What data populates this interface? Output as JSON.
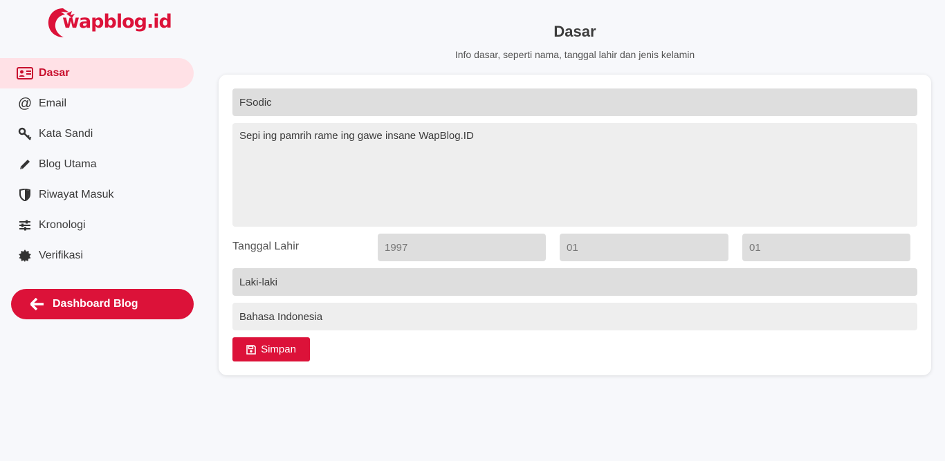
{
  "brand": {
    "logo_text": "wapblog.id",
    "accent": "#dc1239",
    "active_bg": "#ffe1e6"
  },
  "sidebar": {
    "items": [
      {
        "label": "Dasar",
        "icon": "id-card-icon",
        "active": true
      },
      {
        "label": "Email",
        "icon": "at-icon"
      },
      {
        "label": "Kata Sandi",
        "icon": "key-icon"
      },
      {
        "label": "Blog Utama",
        "icon": "pencil-icon"
      },
      {
        "label": "Riwayat Masuk",
        "icon": "shield-icon"
      },
      {
        "label": "Kronologi",
        "icon": "sliders-icon"
      },
      {
        "label": "Verifikasi",
        "icon": "badge-icon"
      }
    ],
    "dashboard_label": "Dashboard Blog"
  },
  "main": {
    "title": "Dasar",
    "subtitle": "Info dasar, seperti nama, tanggal lahir dan jenis kelamin",
    "form": {
      "name_value": "FSodic",
      "bio_value": "Sepi ing pamrih rame ing gawe insane WapBlog.ID",
      "birth_label": "Tanggal Lahir",
      "birth_year": "1997",
      "birth_month": "01",
      "birth_day": "01",
      "gender_value": "Laki-laki",
      "language_value": "Bahasa Indonesia",
      "save_label": "Simpan"
    }
  }
}
